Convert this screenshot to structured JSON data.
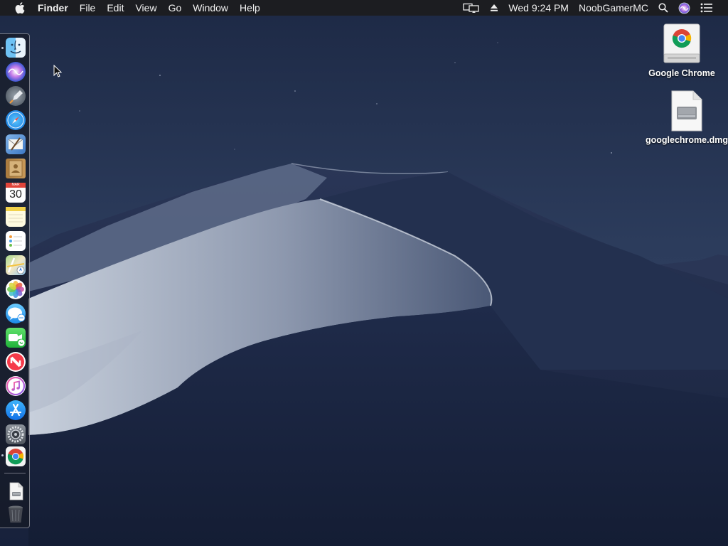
{
  "menubar": {
    "app_name": "Finder",
    "menus": [
      "File",
      "Edit",
      "View",
      "Go",
      "Window",
      "Help"
    ],
    "clock": "Wed 9:24 PM",
    "user": "NoobGamerMC",
    "icons": [
      "apple-icon",
      "airplay-display-icon",
      "eject-icon",
      "spotlight-search-icon",
      "siri-icon",
      "notification-center-icon"
    ]
  },
  "dock": {
    "apps": [
      {
        "name": "Finder",
        "icon": "finder-icon",
        "running": true
      },
      {
        "name": "Siri",
        "icon": "siri-icon",
        "running": false
      },
      {
        "name": "Launchpad",
        "icon": "launchpad-icon",
        "running": false
      },
      {
        "name": "Safari",
        "icon": "safari-icon",
        "running": false
      },
      {
        "name": "Mail",
        "icon": "mail-icon",
        "running": false
      },
      {
        "name": "Contacts",
        "icon": "contacts-icon",
        "running": false
      },
      {
        "name": "Calendar",
        "icon": "calendar-icon",
        "running": false,
        "badge": "30",
        "month": "MAR"
      },
      {
        "name": "Notes",
        "icon": "notes-icon",
        "running": false
      },
      {
        "name": "Reminders",
        "icon": "reminders-icon",
        "running": false
      },
      {
        "name": "Maps",
        "icon": "maps-icon",
        "running": false
      },
      {
        "name": "Photos",
        "icon": "photos-icon",
        "running": false
      },
      {
        "name": "Messages",
        "icon": "messages-icon",
        "running": false
      },
      {
        "name": "FaceTime",
        "icon": "facetime-icon",
        "running": false
      },
      {
        "name": "News",
        "icon": "news-icon",
        "running": false
      },
      {
        "name": "iTunes",
        "icon": "itunes-icon",
        "running": false
      },
      {
        "name": "App Store",
        "icon": "app-store-icon",
        "running": false
      },
      {
        "name": "System Preferences",
        "icon": "system-preferences-icon",
        "running": false
      },
      {
        "name": "Google Chrome",
        "icon": "chrome-icon",
        "running": true
      }
    ],
    "stacks": [
      {
        "name": "Downloads",
        "icon": "disk-image-icon"
      },
      {
        "name": "Trash",
        "icon": "trash-icon"
      }
    ]
  },
  "desktop_icons": [
    {
      "label": "Google Chrome",
      "icon": "chrome-volume-icon"
    },
    {
      "label": "googlechrome.dmg",
      "icon": "dmg-file-icon"
    }
  ],
  "colors": {
    "menubar_bg": "#1c1c1e",
    "sky_top": "#1f2b48",
    "sky_mid": "#2d3d5c",
    "dune_light": "#9aa6bb",
    "dune_dark": "#1e2a48"
  }
}
